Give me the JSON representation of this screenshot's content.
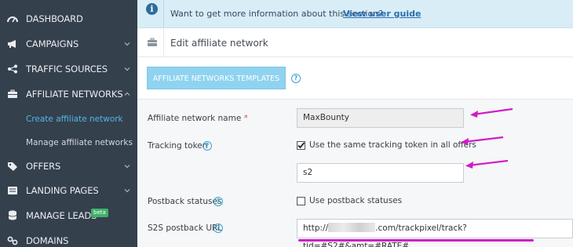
{
  "sidebar": {
    "items": [
      {
        "label": "DASHBOARD",
        "icon": "dashboard-icon",
        "chevron": false
      },
      {
        "label": "CAMPAIGNS",
        "icon": "megaphone-icon",
        "chevron": true
      },
      {
        "label": "TRAFFIC SOURCES",
        "icon": "share-icon",
        "chevron": true
      },
      {
        "label": "AFFILIATE NETWORKS",
        "icon": "briefcase-icon",
        "chevron": true
      },
      {
        "label": "OFFERS",
        "icon": "tag-icon",
        "chevron": true
      },
      {
        "label": "LANDING PAGES",
        "icon": "landing-icon",
        "chevron": true
      },
      {
        "label": "MANAGE LEADS",
        "icon": "database-icon",
        "chevron": false
      },
      {
        "label": "DOMAINS",
        "icon": "link-icon",
        "chevron": false
      }
    ],
    "sub_items": [
      {
        "label": "Create affiliate network",
        "active": true
      },
      {
        "label": "Manage affiliate networks",
        "active": false
      }
    ],
    "beta_badge": "beta"
  },
  "info": {
    "text": "Want to get more information about this section?",
    "link": "View user guide"
  },
  "header": {
    "title": "Edit affiliate network"
  },
  "templates_button": "AFFILIATE NETWORKS TEMPLATES",
  "form": {
    "network_name_label": "Affiliate network name",
    "required_mark": "*",
    "network_name_value": "MaxBounty",
    "tracking_token_label": "Tracking token",
    "same_token_label": "Use the same tracking token in all offers",
    "same_token_checked": true,
    "token_value": "s2",
    "postback_statuses_label": "Postback statuses",
    "use_postback_label": "Use postback statuses",
    "use_postback_checked": false,
    "s2s_label": "S2S postback URL",
    "s2s_prefix": "http://",
    "s2s_suffix": ".com/trackpixel/track?tid=#S2#&amt=#RATE#"
  },
  "colors": {
    "sidebar_bg": "#35404d",
    "active_link": "#4fb8e8",
    "annotation": "#d21bc6",
    "info_bg": "#d9edf7"
  }
}
